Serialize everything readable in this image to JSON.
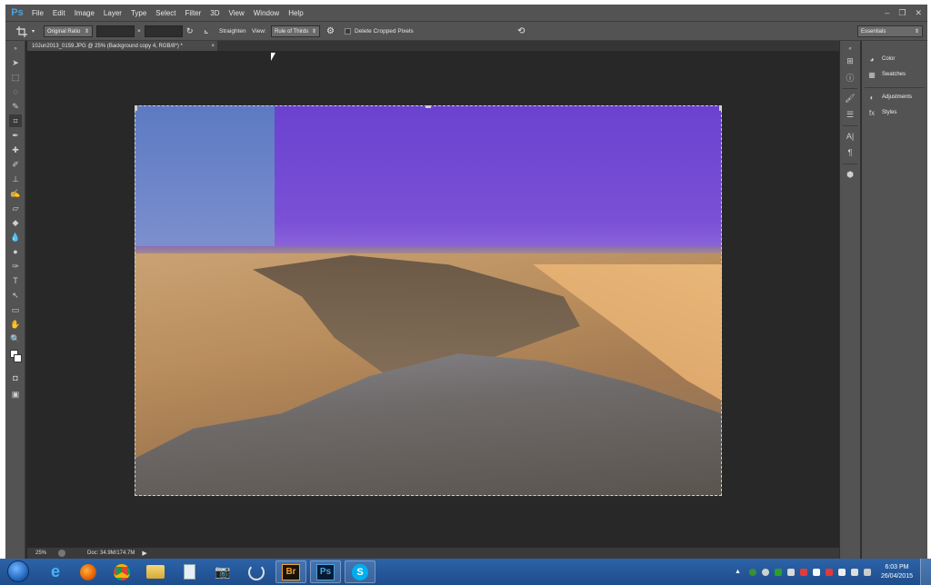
{
  "app": {
    "logo": "Ps",
    "menu": [
      "File",
      "Edit",
      "Image",
      "Layer",
      "Type",
      "Select",
      "Filter",
      "3D",
      "View",
      "Window",
      "Help"
    ]
  },
  "options_bar": {
    "ratio_select": "Original Ratio",
    "times_symbol": "×",
    "straighten_label": "Straighten",
    "view_label": "View:",
    "view_select": "Rule of Thirds",
    "delete_cropped_label": "Delete Cropped Pixels",
    "workspace_select": "Essentials"
  },
  "document": {
    "tab_title": "10Jun2013_0159.JPG @ 25% (Background copy 4, RGB/8*) *",
    "tab_close": "×"
  },
  "status": {
    "zoom": "25%",
    "doc_size": "Doc: 34.9M/174.7M"
  },
  "panels": {
    "color": "Color",
    "swatches": "Swatches",
    "adjustments": "Adjustments",
    "styles": "Styles"
  },
  "taskbar": {
    "time": "6:03 PM",
    "date": "26/04/2015",
    "bridge_label": "Br",
    "photoshop_label": "Ps",
    "skype_label": "S"
  },
  "colors": {
    "ui_dark": "#535353",
    "canvas_bg": "#282828",
    "sky": "#6a42cf",
    "taskbar": "#2c63a8"
  }
}
